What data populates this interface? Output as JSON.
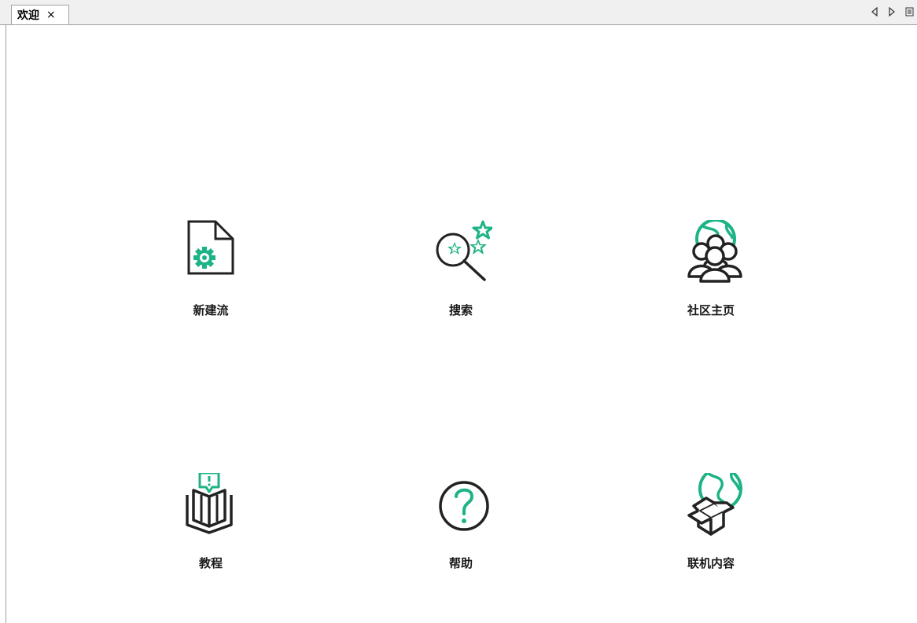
{
  "tabs": [
    {
      "label": "欢迎",
      "close": "×"
    }
  ],
  "nav": {
    "prev_icon": "triangle-left-icon",
    "next_icon": "triangle-right-icon",
    "menu_icon": "list-menu-icon"
  },
  "tiles": [
    {
      "label": "新建流",
      "icon": "new-document-gear-icon"
    },
    {
      "label": "搜索",
      "icon": "search-stars-icon"
    },
    {
      "label": "社区主页",
      "icon": "community-globe-people-icon"
    },
    {
      "label": "教程",
      "icon": "book-notification-icon"
    },
    {
      "label": "帮助",
      "icon": "help-question-icon"
    },
    {
      "label": "联机内容",
      "icon": "online-box-globe-icon"
    }
  ],
  "colors": {
    "accent": "#1db386",
    "stroke": "#222222",
    "tabbar_bg": "#f0f0f0",
    "border": "#a0a0a0"
  }
}
